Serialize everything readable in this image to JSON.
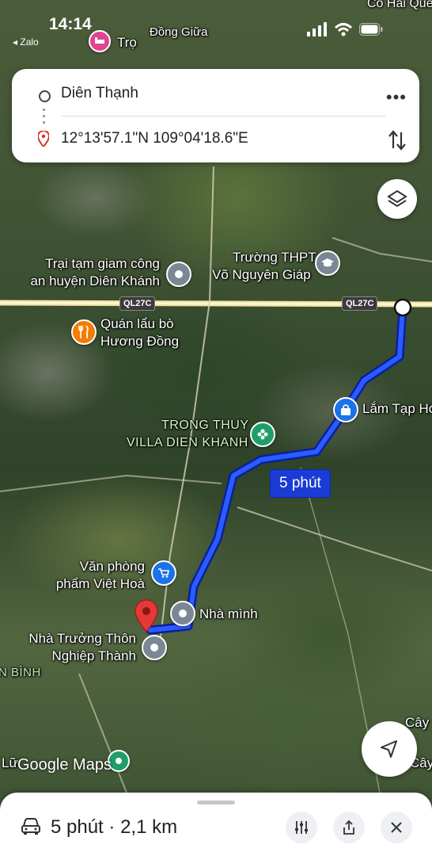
{
  "status_bar": {
    "time": "14:14",
    "back_app": "◂ Zalo"
  },
  "route": {
    "origin": "Diên Thạnh",
    "destination": "12°13'57.1\"N 109°04'18.6\"E"
  },
  "map": {
    "labels": {
      "dong_giua": "Đồng Giữa",
      "co_hai": "Cổ Hai Quế",
      "tro": "Trọ",
      "trai_tam_giam_1": "Trại tạm giam công",
      "trai_tam_giam_2": "an huyện Diên Khánh",
      "truong_thpt_1": "Trường THPT",
      "truong_thpt_2": "Võ Nguyên Giáp",
      "quan_lau_1": "Quán lẩu bò",
      "quan_lau_2": "Hương Đồng",
      "lam_tap_hoa": "Lắm Tạp Hó",
      "villa_1": "TRONG THUY",
      "villa_2": "VILLA DIEN KHANH",
      "van_phong_1": "Văn phòng",
      "van_phong_2": "phẩm Việt Hoà",
      "nha_minh": "Nhà mình",
      "nha_truong_thon_1": "Nhà Trưởng Thôn",
      "nha_truong_thon_2": "Nghiệp Thành",
      "binh": "N BÌNH",
      "cay_1": "Cây",
      "cay_2": "Cây",
      "lu": "Lữ"
    },
    "road_shields": [
      "QL27C",
      "QL27C"
    ],
    "duration_chip": "5 phút",
    "logo": "Google Maps",
    "route_color": "#1a3bd6"
  },
  "summary": {
    "duration": "5 phút",
    "separator": " · ",
    "distance": "2,1 km"
  },
  "icons": {
    "origin": "hollow-circle-icon",
    "destination": "red-pin-icon",
    "more": "more-dots-icon",
    "swap": "swap-vertical-icon",
    "layers": "layers-icon",
    "locate": "navigation-arrow-icon",
    "car": "car-icon",
    "filters": "sliders-icon",
    "share": "share-icon",
    "close": "close-icon"
  }
}
